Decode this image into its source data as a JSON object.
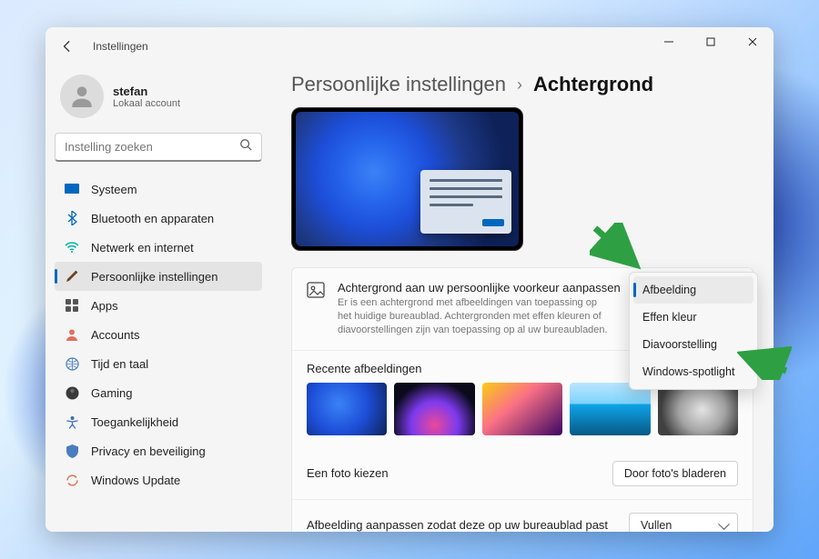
{
  "titlebar": {
    "title": "Instellingen"
  },
  "profile": {
    "name": "stefan",
    "subtitle": "Lokaal account"
  },
  "search": {
    "placeholder": "Instelling zoeken"
  },
  "nav": {
    "items": [
      {
        "label": "Systeem"
      },
      {
        "label": "Bluetooth en apparaten"
      },
      {
        "label": "Netwerk en internet"
      },
      {
        "label": "Persoonlijke instellingen"
      },
      {
        "label": "Apps"
      },
      {
        "label": "Accounts"
      },
      {
        "label": "Tijd en taal"
      },
      {
        "label": "Gaming"
      },
      {
        "label": "Toegankelijkheid"
      },
      {
        "label": "Privacy en beveiliging"
      },
      {
        "label": "Windows Update"
      }
    ]
  },
  "breadcrumb": {
    "parent": "Persoonlijke instellingen",
    "current": "Achtergrond"
  },
  "background_card": {
    "title": "Achtergrond aan uw persoonlijke voorkeur aanpassen",
    "description": "Er is een achtergrond met afbeeldingen van toepassing op het huidige bureaublad. Achtergronden met effen kleuren of diavoorstellingen zijn van toepassing op al uw bureaubladen.",
    "dropdown": {
      "options": [
        {
          "label": "Afbeelding"
        },
        {
          "label": "Effen kleur"
        },
        {
          "label": "Diavoorstelling"
        },
        {
          "label": "Windows-spotlight"
        }
      ]
    }
  },
  "recent": {
    "title": "Recente afbeeldingen"
  },
  "choose_photo": {
    "label": "Een foto kiezen",
    "button": "Door foto's bladeren"
  },
  "fit": {
    "label": "Afbeelding aanpassen zodat deze op uw bureaublad past",
    "value": "Vullen"
  }
}
